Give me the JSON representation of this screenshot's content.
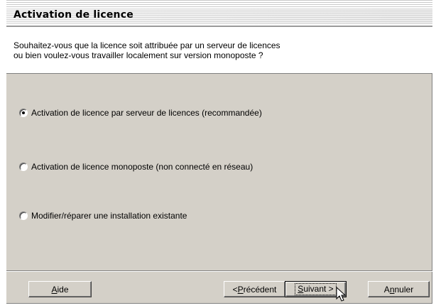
{
  "window": {
    "title": "Activation de licence",
    "question_lines": [
      "Souhaitez-vous que la licence soit attribuée par un serveur de licences",
      "ou bien voulez-vous travailler localement sur version monoposte ?"
    ]
  },
  "options": [
    {
      "label": "Activation de licence par serveur de licences (recommandée)",
      "checked": true
    },
    {
      "label": "Activation de licence monoposte (non connecté en réseau)",
      "checked": false
    },
    {
      "label": "Modifier/réparer une installation existante",
      "checked": false
    }
  ],
  "buttons": {
    "help": {
      "mnemonic": "A",
      "rest": "ide"
    },
    "previous": {
      "prefix": "<",
      "mnemonic": "P",
      "rest": "récédent"
    },
    "next": {
      "mnemonic": "S",
      "rest": "uivant >"
    },
    "cancel": {
      "prefix": "A",
      "mnemonic": "n",
      "rest": "nuler"
    }
  },
  "icons": {
    "pointer": "arrow-cursor-icon"
  }
}
